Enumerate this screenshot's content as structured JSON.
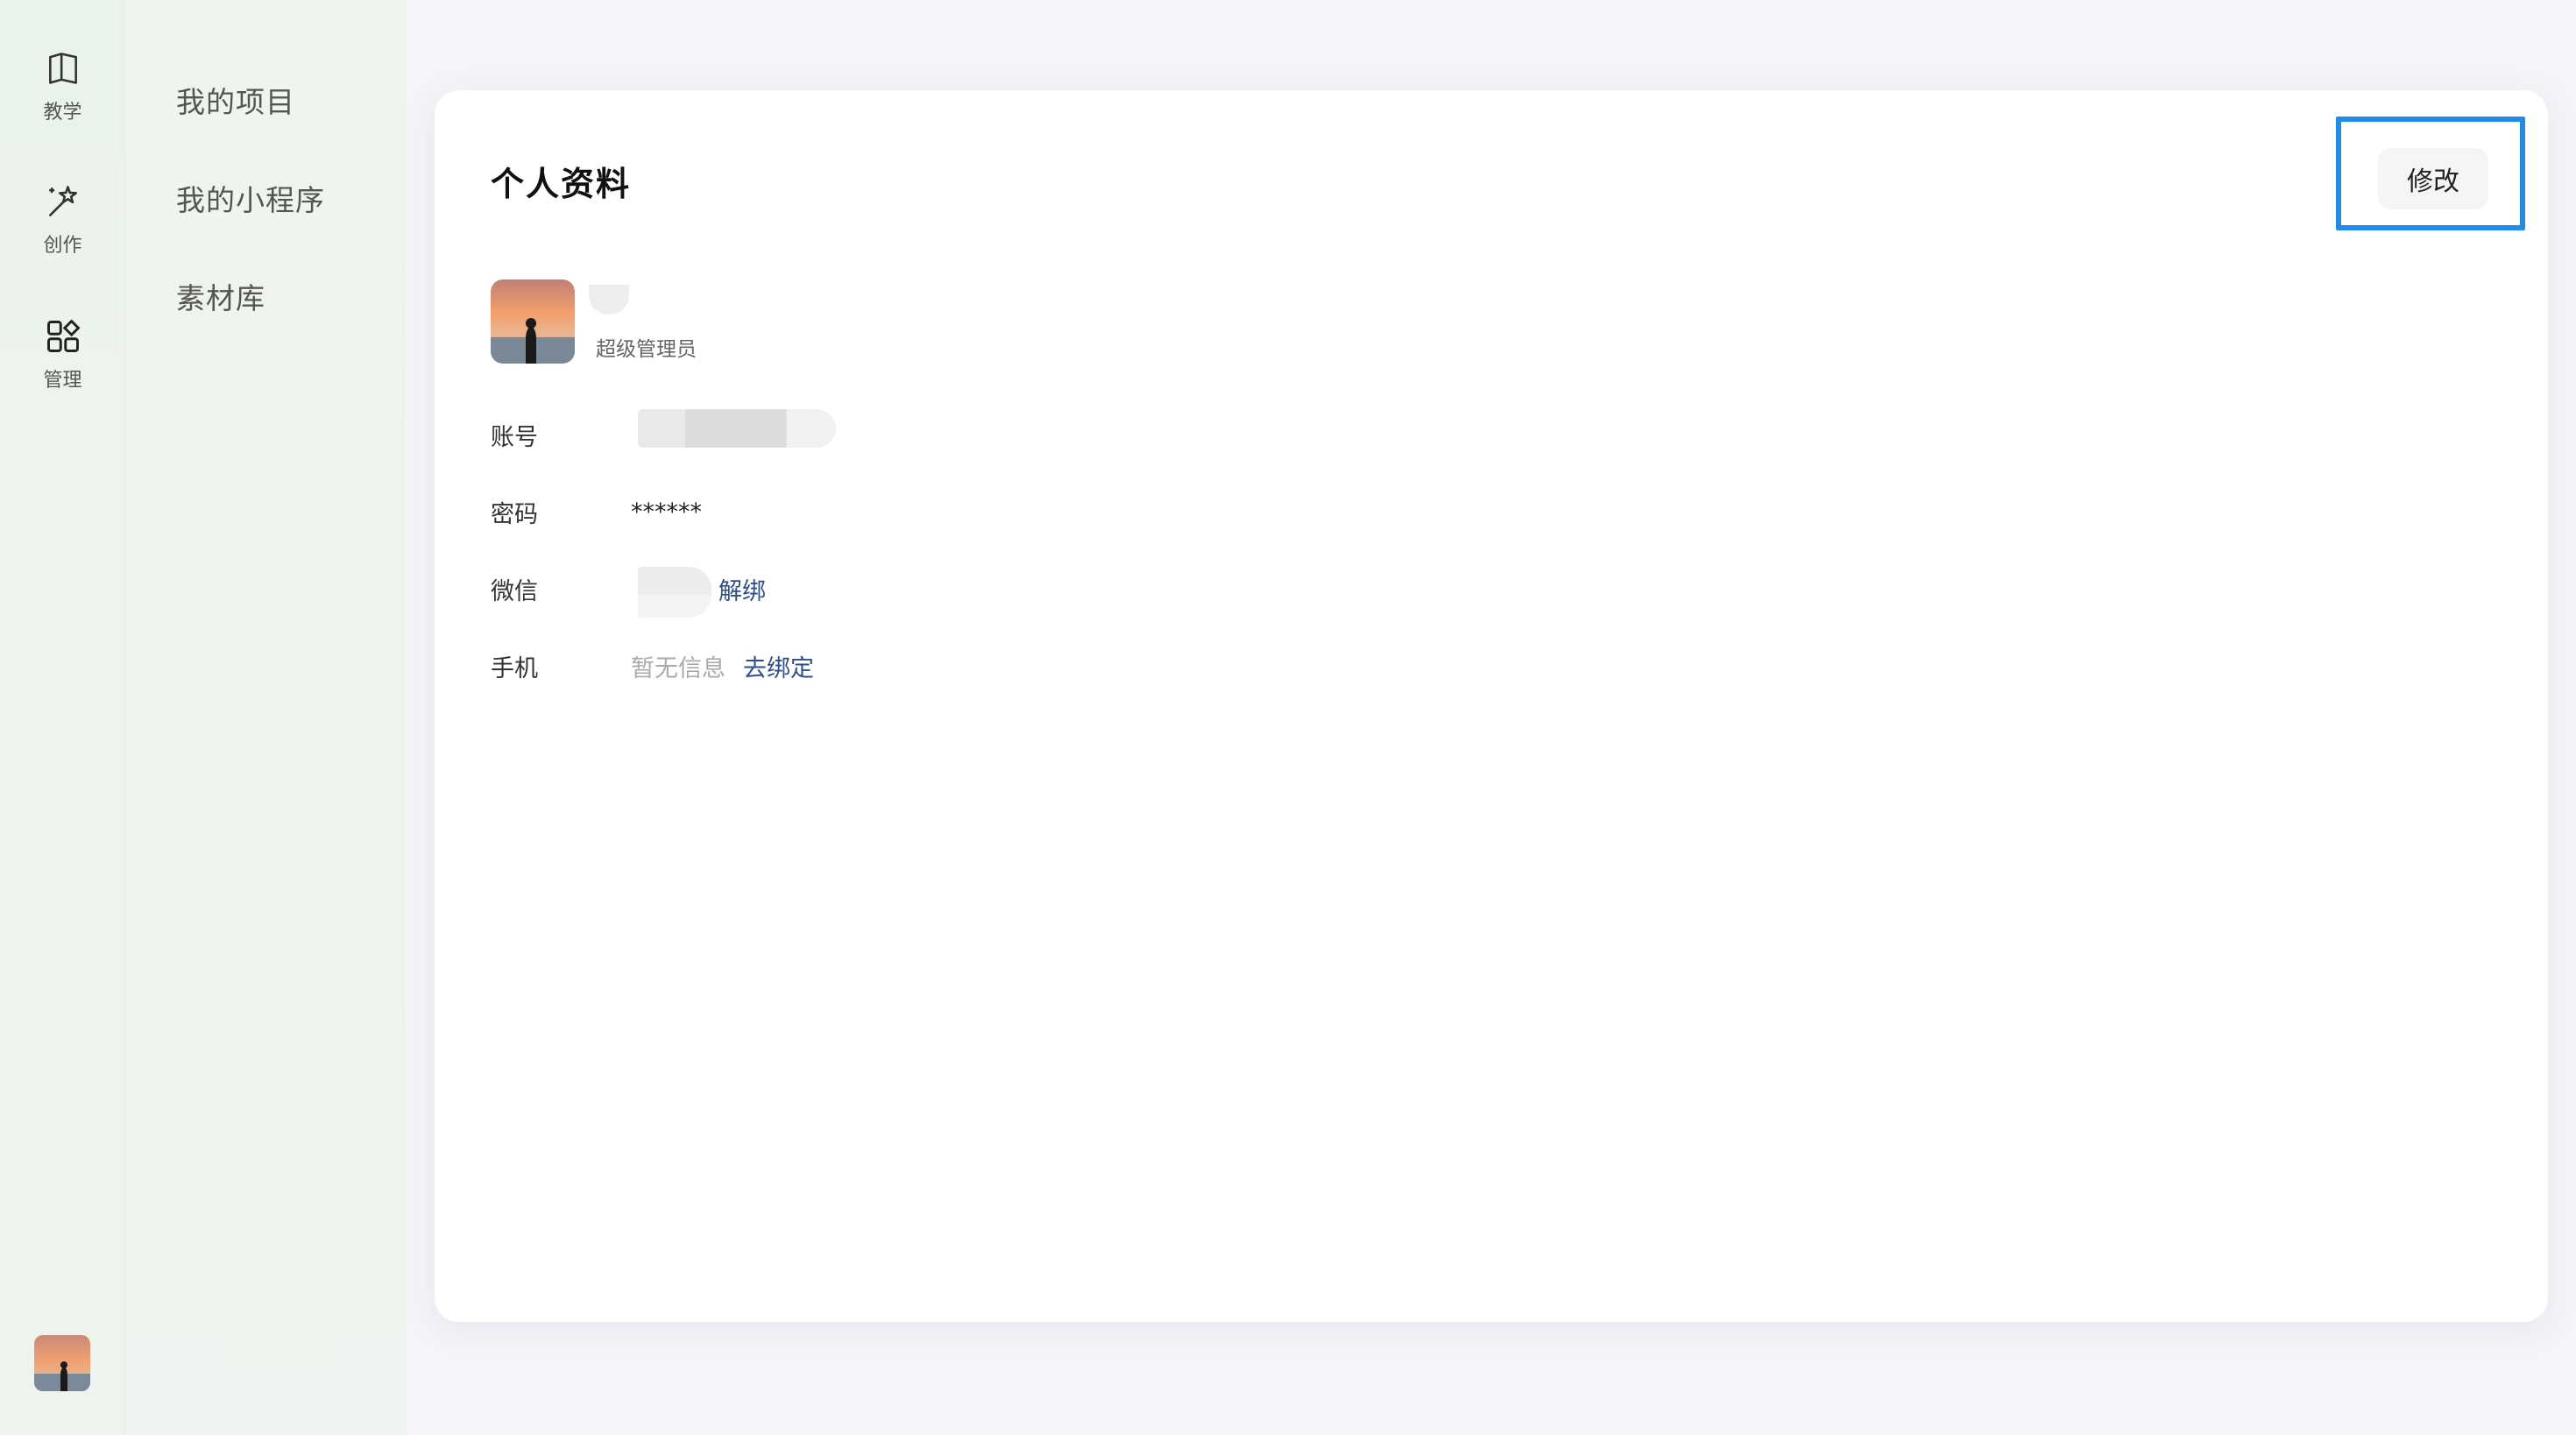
{
  "rail": {
    "items": [
      {
        "label": "教学",
        "icon": "book-icon"
      },
      {
        "label": "创作",
        "icon": "magic-wand-icon"
      },
      {
        "label": "管理",
        "icon": "grid-icon"
      }
    ]
  },
  "subnav": {
    "items": [
      "我的项目",
      "我的小程序",
      "素材库"
    ]
  },
  "profile": {
    "title": "个人资料",
    "edit_label": "修改",
    "role": "超级管理员",
    "fields": {
      "account_label": "账号",
      "password_label": "密码",
      "password_value": "******",
      "wechat_label": "微信",
      "wechat_action": "解绑",
      "phone_label": "手机",
      "phone_value": "暂无信息",
      "phone_action": "去绑定"
    }
  },
  "colors": {
    "highlight": "#1e8ce8",
    "link": "#2f4e8f"
  }
}
